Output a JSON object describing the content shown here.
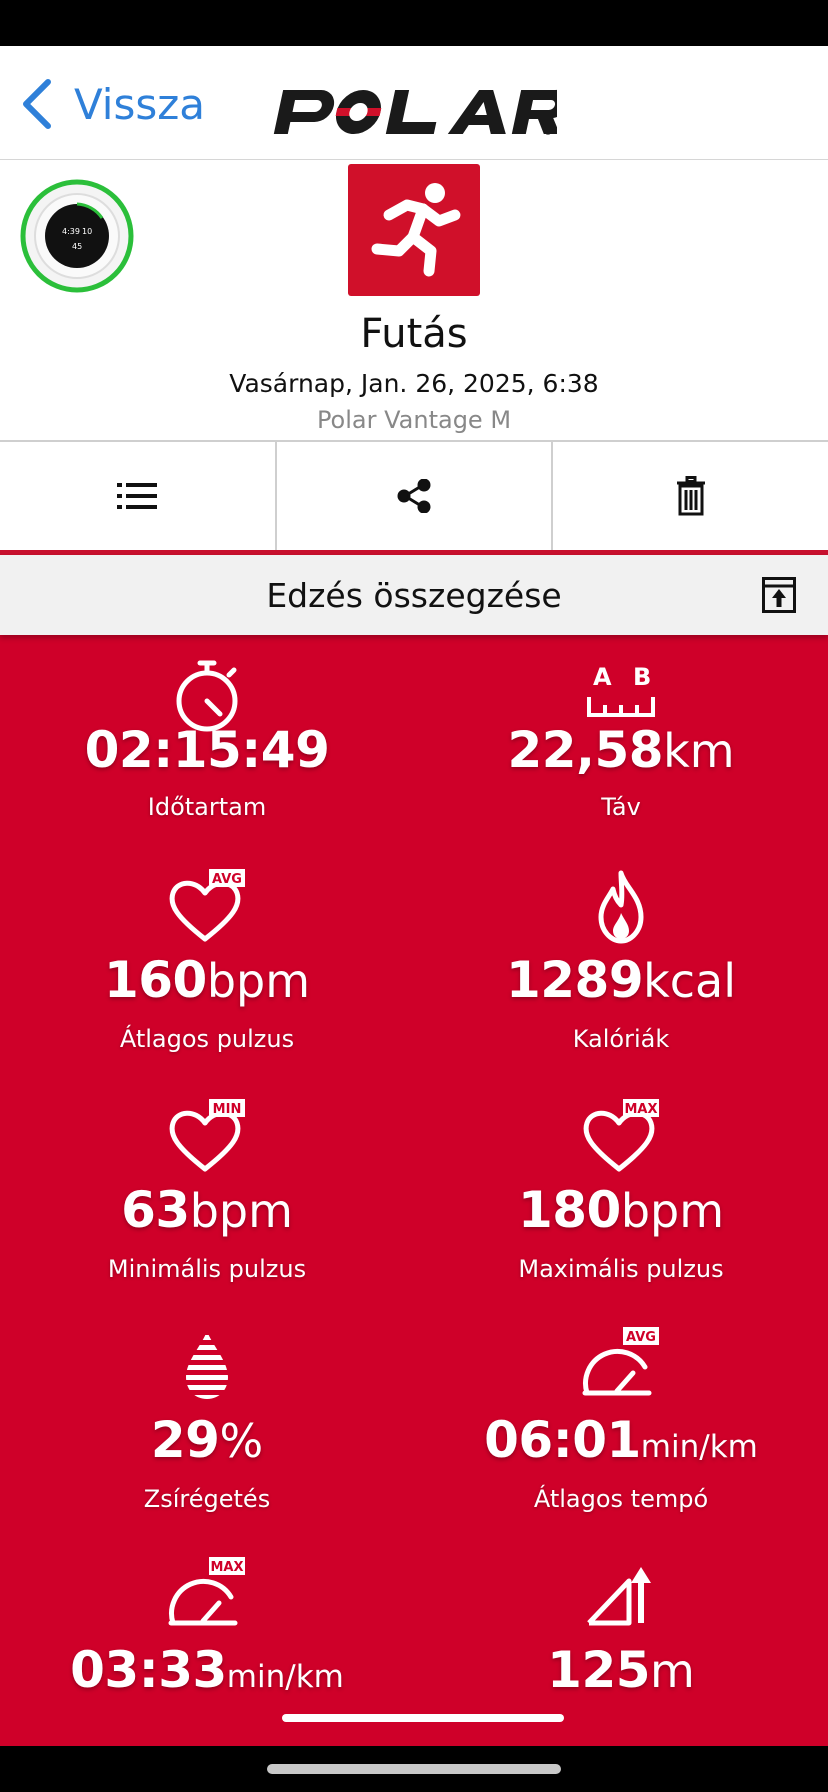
{
  "nav": {
    "back_label": "Vissza",
    "logo_text": "POLAR"
  },
  "header": {
    "sport": "Futás",
    "date": "Vasárnap, Jan. 26, 2025, 6:38",
    "device": "Polar Vantage M",
    "watch_display": {
      "line1": "4:39",
      "line2": "10",
      "line3": "45"
    }
  },
  "summary": {
    "title": "Edzés összegzése"
  },
  "stats": [
    {
      "icon": "stopwatch-icon",
      "value": "02:15:49",
      "unit": "",
      "label": "Időtartam"
    },
    {
      "icon": "distance-ab-icon",
      "value": "22,58",
      "unit": "km",
      "label": "Táv",
      "icon_letters": [
        "A",
        "B"
      ]
    },
    {
      "icon": "heart-avg-icon",
      "value": "160",
      "unit": "bpm",
      "label": "Átlagos pulzus",
      "badge": "AVG"
    },
    {
      "icon": "flame-icon",
      "value": "1289",
      "unit": "kcal",
      "label": "Kalóriák"
    },
    {
      "icon": "heart-min-icon",
      "value": "63",
      "unit": "bpm",
      "label": "Minimális pulzus",
      "badge": "MIN"
    },
    {
      "icon": "heart-max-icon",
      "value": "180",
      "unit": "bpm",
      "label": "Maximális pulzus",
      "badge": "MAX"
    },
    {
      "icon": "fat-burn-icon",
      "value": "29",
      "unit": "%",
      "label": "Zsírégetés"
    },
    {
      "icon": "pace-avg-icon",
      "value": "06:01",
      "unit": "min/km",
      "label": "Átlagos tempó",
      "badge": "AVG"
    },
    {
      "icon": "pace-max-icon",
      "value": "03:33",
      "unit": "min/km",
      "label": "",
      "badge": "MAX"
    },
    {
      "icon": "ascent-icon",
      "value": "125",
      "unit": "m",
      "label": ""
    }
  ],
  "colors": {
    "brand_red": "#cf0029",
    "link_blue": "#2f80d9",
    "ring_green": "#2bbf3a"
  }
}
